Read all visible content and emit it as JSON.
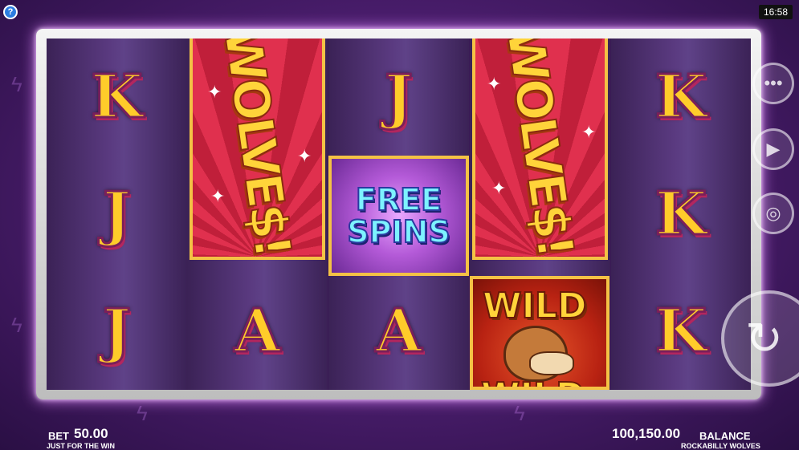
{
  "header": {
    "help_label": "?",
    "clock": "16:58"
  },
  "reels": {
    "reel1": [
      "K",
      "J",
      "J"
    ],
    "reel2": {
      "tall_symbol": "WOLVE$!",
      "bottom": "A"
    },
    "reel3": {
      "top": "J",
      "middle": {
        "line1": "FREE",
        "line2": "SPINS"
      },
      "bottom": "A"
    },
    "reel4": {
      "tall_symbol": "WOLVE$!",
      "wild_top": "WILD",
      "wild_bottom": "WILD"
    },
    "reel5": [
      "K",
      "K",
      "K"
    ]
  },
  "controls": {
    "menu_icon": "ellipsis-icon",
    "autoplay_icon": "autoplay-icon",
    "chip_icon": "chip-icon",
    "spin_icon": "spin-arrow-icon"
  },
  "footer": {
    "bet_label": "BET",
    "bet_value": "50.00",
    "left_caption": "JUST FOR THE WIN",
    "balance_value": "100,150.00",
    "balance_label": "BALANCE",
    "right_caption": "ROCKABILLY WOLVES"
  }
}
